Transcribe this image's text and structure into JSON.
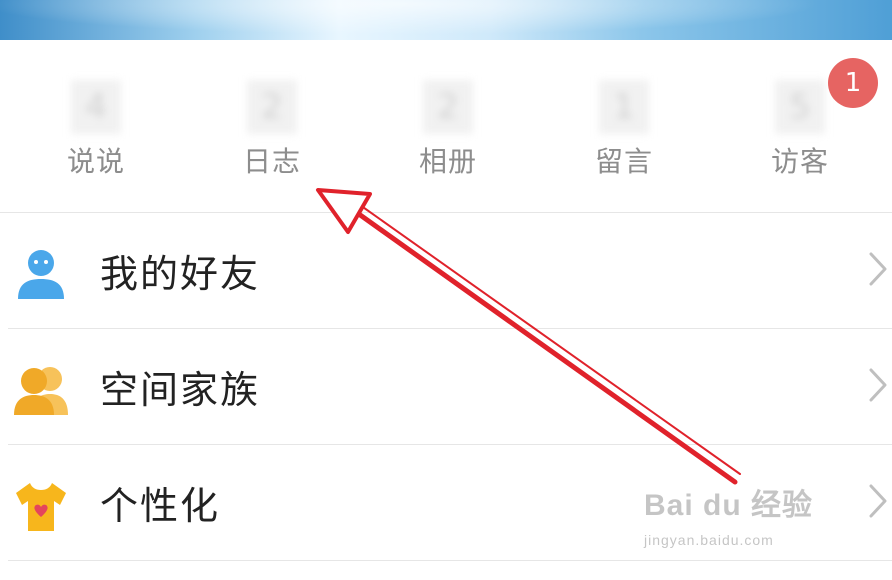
{
  "stats": [
    {
      "label": "说说",
      "count": "4"
    },
    {
      "label": "日志",
      "count": "2"
    },
    {
      "label": "相册",
      "count": "2"
    },
    {
      "label": "留言",
      "count": "1"
    },
    {
      "label": "访客",
      "count": "5"
    }
  ],
  "badge": {
    "value": "1",
    "color": "#e66462"
  },
  "menu": [
    {
      "title": "我的好友",
      "icon": "friend-person-icon"
    },
    {
      "title": "空间家族",
      "icon": "family-group-icon"
    },
    {
      "title": "个性化",
      "icon": "tshirt-heart-icon"
    }
  ],
  "watermark": {
    "brand": "Bai du 经验",
    "url": "jingyan.baidu.com"
  },
  "colors": {
    "annotation_arrow": "#e0222b",
    "friend_icon": "#4aa7ea",
    "family_icon": "#f0a928",
    "personalize_icon": "#f7b61c"
  }
}
